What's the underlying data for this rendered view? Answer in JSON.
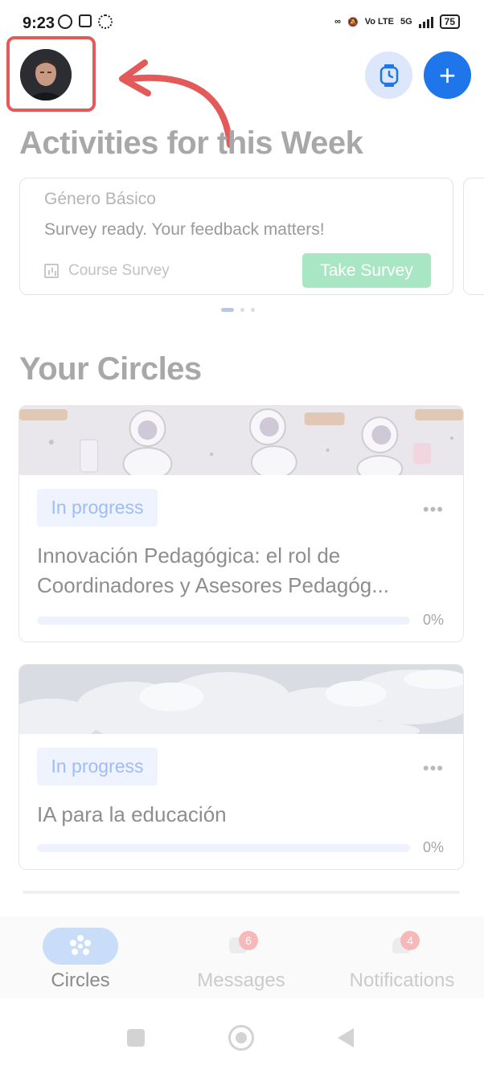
{
  "status_bar": {
    "time": "9:23",
    "battery": "75",
    "network": "5G",
    "volte": "Vo LTE"
  },
  "header": {
    "profile_icon": "avatar-photo",
    "timer_icon": "stopwatch-icon",
    "add_icon": "+",
    "annotation_color": "#e25a5a"
  },
  "activities": {
    "title": "Activities for this Week",
    "cards": [
      {
        "course": "Género Básico",
        "message": "Survey ready. Your feedback matters!",
        "type_label": "Course Survey",
        "button_label": "Take Survey"
      }
    ],
    "pager_count": 3,
    "pager_active": 0
  },
  "circles": {
    "title": "Your Circles",
    "items": [
      {
        "status": "In progress",
        "title": "Innovación Pedagógica: el rol de Coordinadores y Asesores Pedagóg...",
        "progress": 0,
        "progress_label": "0%",
        "more": "•••",
        "banner": "astronaut-pattern"
      },
      {
        "status": "In progress",
        "title": "IA para la educación",
        "progress": 0,
        "progress_label": "0%",
        "more": "•••",
        "banner": "clouds"
      }
    ]
  },
  "bottom_nav": {
    "items": [
      {
        "label": "Circles",
        "active": true,
        "icon": "circles-icon"
      },
      {
        "label": "Messages",
        "badge": "6",
        "icon": "chat-icon"
      },
      {
        "label": "Notifications",
        "badge": "4",
        "icon": "bell-icon"
      }
    ]
  },
  "colors": {
    "primary": "#1f76ea",
    "survey_button": "#a9e6c4",
    "badge_bg": "#eef3fd",
    "badge_text": "#9dbdf4"
  }
}
